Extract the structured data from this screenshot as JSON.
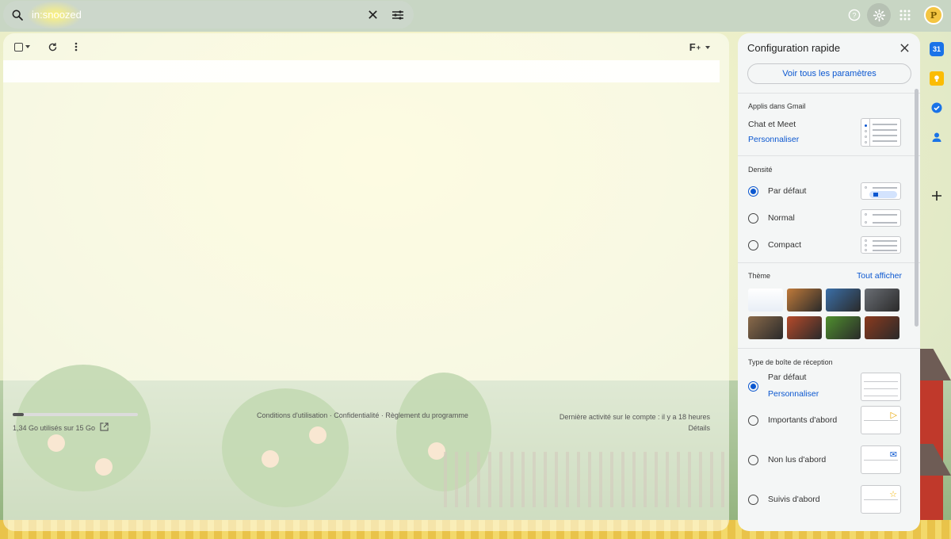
{
  "search": {
    "value": "in:snoozed"
  },
  "header": {
    "avatar_letter": "P"
  },
  "main": {
    "density_label": "F",
    "storage": {
      "text": "1,34 Go utilisés sur 15 Go",
      "used_fraction": 0.09
    },
    "footer": {
      "terms": "Conditions d'utilisation",
      "sep1": " · ",
      "privacy": "Confidentialité",
      "sep2": " · ",
      "program": "Règlement du programme"
    },
    "activity": {
      "last": "Dernière activité sur le compte : il y a 18 heures",
      "details": "Détails"
    }
  },
  "quick_settings": {
    "title": "Configuration rapide",
    "see_all": "Voir tous les paramètres",
    "apps": {
      "label": "Applis dans Gmail",
      "item": "Chat et Meet",
      "customize": "Personnaliser"
    },
    "density": {
      "label": "Densité",
      "options": [
        "Par défaut",
        "Normal",
        "Compact"
      ],
      "selected": "Par défaut"
    },
    "theme": {
      "label": "Thème",
      "show_all": "Tout afficher",
      "swatches": [
        "#e8eef6",
        "#c07a3a",
        "#3b6fa8",
        "#6a6e74",
        "#8a6a4a",
        "#b64a2a",
        "#4f8f2e",
        "#8b3a1e"
      ]
    },
    "inbox_type": {
      "label": "Type de boîte de réception",
      "options": [
        "Par défaut",
        "Importants d'abord",
        "Non lus d'abord",
        "Suivis d'abord"
      ],
      "customize": "Personnaliser",
      "selected": "Par défaut"
    }
  },
  "rail": {
    "apps": [
      "calendar-icon",
      "keep-icon",
      "tasks-icon",
      "contacts-icon",
      "add-icon"
    ],
    "calendar_label": "31"
  },
  "colors": {
    "accent": "#0b57d0",
    "avatar": "#f4c542"
  }
}
